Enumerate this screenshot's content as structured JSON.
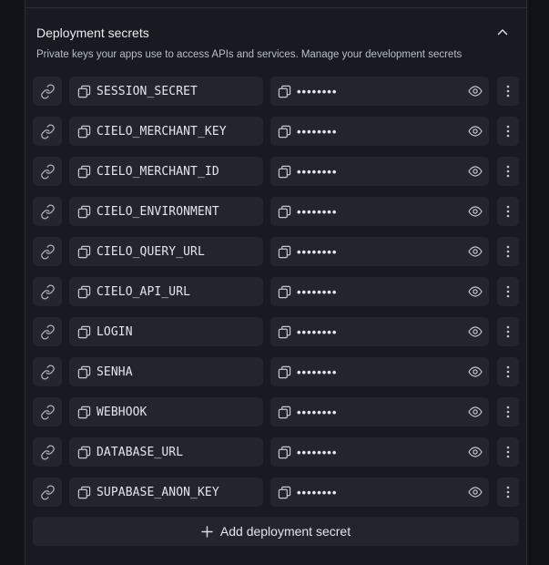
{
  "section": {
    "title": "Deployment secrets",
    "description": "Private keys your apps use to access APIs and services. Manage your development secrets"
  },
  "icons": {
    "link": "link-icon",
    "copy": "copy-icon",
    "eye": "eye-icon",
    "more": "more-vertical-icon",
    "collapse": "chevron-up-icon",
    "add": "plus-icon"
  },
  "secrets": [
    {
      "key": "SESSION_SECRET",
      "value": "••••••••"
    },
    {
      "key": "CIELO_MERCHANT_KEY",
      "value": "••••••••"
    },
    {
      "key": "CIELO_MERCHANT_ID",
      "value": "••••••••"
    },
    {
      "key": "CIELO_ENVIRONMENT",
      "value": "••••••••"
    },
    {
      "key": "CIELO_QUERY_URL",
      "value": "••••••••"
    },
    {
      "key": "CIELO_API_URL",
      "value": "••••••••"
    },
    {
      "key": "LOGIN",
      "value": "••••••••"
    },
    {
      "key": "SENHA",
      "value": "••••••••"
    },
    {
      "key": "WEBHOOK",
      "value": "••••••••"
    },
    {
      "key": "DATABASE_URL",
      "value": "••••••••"
    },
    {
      "key": "SUPABASE_ANON_KEY",
      "value": "••••••••"
    }
  ],
  "add_button_label": "Add deployment secret"
}
